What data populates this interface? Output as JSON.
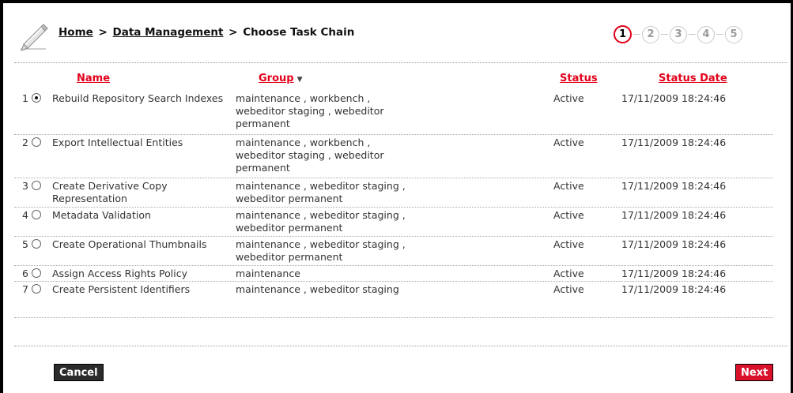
{
  "breadcrumb": {
    "home": "Home",
    "sep1": ">",
    "data_management": "Data Management",
    "sep2": ">",
    "current": "Choose Task Chain"
  },
  "steps": [
    "1",
    "2",
    "3",
    "4",
    "5"
  ],
  "active_step": "1",
  "table": {
    "headers": {
      "name": "Name",
      "group": "Group",
      "status": "Status",
      "status_date": "Status Date"
    },
    "rows": [
      {
        "num": "1",
        "selected": true,
        "name": "Rebuild Repository Search Indexes",
        "group": "maintenance , workbench , webeditor staging , webeditor permanent",
        "status": "Active",
        "date": "17/11/2009 18:24:46"
      },
      {
        "num": "2",
        "selected": false,
        "name": "Export Intellectual Entities",
        "group": "maintenance , workbench , webeditor staging , webeditor permanent",
        "status": "Active",
        "date": "17/11/2009 18:24:46"
      },
      {
        "num": "3",
        "selected": false,
        "name": "Create Derivative Copy Representation",
        "group": "maintenance , webeditor staging , webeditor permanent",
        "status": "Active",
        "date": "17/11/2009 18:24:46"
      },
      {
        "num": "4",
        "selected": false,
        "name": "Metadata Validation",
        "group": "maintenance , webeditor staging , webeditor permanent",
        "status": "Active",
        "date": "17/11/2009 18:24:46"
      },
      {
        "num": "5",
        "selected": false,
        "name": "Create Operational Thumbnails",
        "group": "maintenance , webeditor staging , webeditor permanent",
        "status": "Active",
        "date": "17/11/2009 18:24:46"
      },
      {
        "num": "6",
        "selected": false,
        "name": "Assign Access Rights Policy",
        "group": "maintenance",
        "status": "Active",
        "date": "17/11/2009 18:24:46"
      },
      {
        "num": "7",
        "selected": false,
        "name": "Create Persistent Identifiers",
        "group": "maintenance , webeditor staging",
        "status": "Active",
        "date": "17/11/2009 18:24:46"
      }
    ]
  },
  "buttons": {
    "cancel": "Cancel",
    "next": "Next"
  },
  "colors": {
    "accent": "#e2001a",
    "next_button": "#d9112a",
    "cancel_button": "#2b2b2b"
  },
  "icons": {
    "header": "pencil-icon"
  }
}
